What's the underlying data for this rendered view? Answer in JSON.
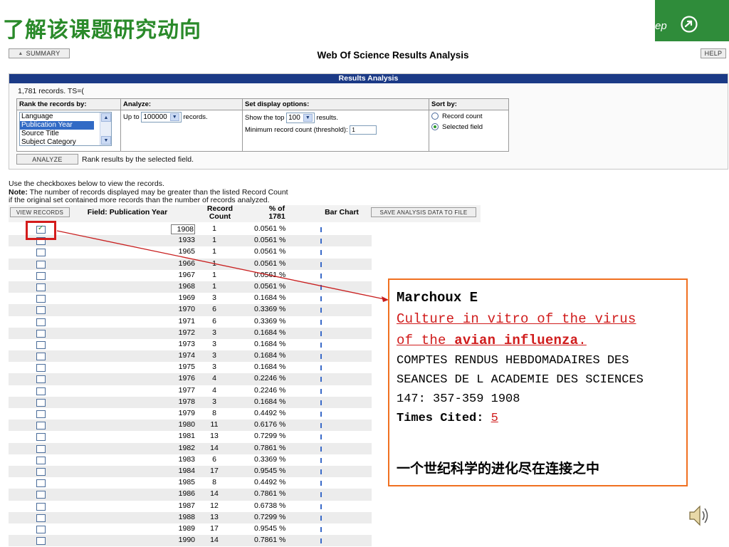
{
  "slide": {
    "title": "了解该课题研究动向",
    "step_text": "ep",
    "step_icon": "arrow-circle-icon",
    "speaker_icon": "speaker-icon"
  },
  "header": {
    "summary_label": "SUMMARY",
    "title": "Web Of Science Results Analysis",
    "help_label": "HELP"
  },
  "analysis": {
    "panel_title": "Results Analysis",
    "records_text": "1,781 records. TS=(",
    "rank_header": "Rank the records by:",
    "rank_options": [
      "Language",
      "Publication Year",
      "Source Title",
      "Subject Category"
    ],
    "rank_selected": "Publication Year",
    "analyze_header": "Analyze:",
    "analyze_prefix": "Up to",
    "analyze_value": "100000",
    "analyze_suffix": "records.",
    "display_header": "Set display options:",
    "show_prefix": "Show the top",
    "show_value": "100",
    "show_suffix": "results.",
    "threshold_label": "Minimum record count (threshold):",
    "threshold_value": "1",
    "sort_header": "Sort by:",
    "sort_options": [
      "Record count",
      "Selected field"
    ],
    "sort_selected": "Selected field",
    "analyze_button": "ANALYZE",
    "analyze_note": "Rank results by the selected field."
  },
  "instructions": {
    "line1": "Use the checkboxes below to view the records.",
    "note_label": "Note:",
    "note_text": " The number of records displayed may be greater than the listed Record Count",
    "line3": "if the original set contained more records than the number of records analyzed."
  },
  "results": {
    "view_button": "VIEW RECORDS",
    "field_header": "Field: Publication Year",
    "count_header_1": "Record",
    "count_header_2": "Count",
    "pct_header_1": "% of",
    "pct_header_2": "1781",
    "bar_header": "Bar Chart",
    "save_button": "SAVE ANALYSIS DATA TO FILE",
    "rows": [
      {
        "year": "1908",
        "count": "1",
        "pct": "0.0561 %",
        "checked": true
      },
      {
        "year": "1933",
        "count": "1",
        "pct": "0.0561 %",
        "checked": false
      },
      {
        "year": "1965",
        "count": "1",
        "pct": "0.0561 %",
        "checked": false
      },
      {
        "year": "1966",
        "count": "1",
        "pct": "0.0561 %",
        "checked": false
      },
      {
        "year": "1967",
        "count": "1",
        "pct": "0.0561 %",
        "checked": false
      },
      {
        "year": "1968",
        "count": "1",
        "pct": "0.0561 %",
        "checked": false
      },
      {
        "year": "1969",
        "count": "3",
        "pct": "0.1684 %",
        "checked": false
      },
      {
        "year": "1970",
        "count": "6",
        "pct": "0.3369 %",
        "checked": false
      },
      {
        "year": "1971",
        "count": "6",
        "pct": "0.3369 %",
        "checked": false
      },
      {
        "year": "1972",
        "count": "3",
        "pct": "0.1684 %",
        "checked": false
      },
      {
        "year": "1973",
        "count": "3",
        "pct": "0.1684 %",
        "checked": false
      },
      {
        "year": "1974",
        "count": "3",
        "pct": "0.1684 %",
        "checked": false
      },
      {
        "year": "1975",
        "count": "3",
        "pct": "0.1684 %",
        "checked": false
      },
      {
        "year": "1976",
        "count": "4",
        "pct": "0.2246 %",
        "checked": false
      },
      {
        "year": "1977",
        "count": "4",
        "pct": "0.2246 %",
        "checked": false
      },
      {
        "year": "1978",
        "count": "3",
        "pct": "0.1684 %",
        "checked": false
      },
      {
        "year": "1979",
        "count": "8",
        "pct": "0.4492 %",
        "checked": false
      },
      {
        "year": "1980",
        "count": "11",
        "pct": "0.6176 %",
        "checked": false
      },
      {
        "year": "1981",
        "count": "13",
        "pct": "0.7299 %",
        "checked": false
      },
      {
        "year": "1982",
        "count": "14",
        "pct": "0.7861 %",
        "checked": false
      },
      {
        "year": "1983",
        "count": "6",
        "pct": "0.3369 %",
        "checked": false
      },
      {
        "year": "1984",
        "count": "17",
        "pct": "0.9545 %",
        "checked": false
      },
      {
        "year": "1985",
        "count": "8",
        "pct": "0.4492 %",
        "checked": false
      },
      {
        "year": "1986",
        "count": "14",
        "pct": "0.7861 %",
        "checked": false
      },
      {
        "year": "1987",
        "count": "12",
        "pct": "0.6738 %",
        "checked": false
      },
      {
        "year": "1988",
        "count": "13",
        "pct": "0.7299 %",
        "checked": false
      },
      {
        "year": "1989",
        "count": "17",
        "pct": "0.9545 %",
        "checked": false
      },
      {
        "year": "1990",
        "count": "14",
        "pct": "0.7861 %",
        "checked": false
      }
    ]
  },
  "callout": {
    "author": "Marchoux E",
    "title_part1": "Culture in vitro of the virus",
    "title_part2": "of the ",
    "title_bold": "avian influenza",
    "title_end": ".",
    "journal_1": "COMPTES RENDUS HEBDOMADAIRES DES",
    "journal_2": "SEANCES DE L ACADEMIE DES SCIENCES",
    "citation": "147: 357-359 1908",
    "cited_label": "Times Cited: ",
    "cited_count": "5",
    "chinese_note": "一个世纪科学的进化尽在连接之中"
  },
  "colors": {
    "title_green": "#2a8a2a",
    "step_green": "#2f8c3a",
    "panel_blue": "#1b3a86",
    "highlight_red": "#d41c1c",
    "callout_border": "#f07020",
    "link_red": "#d01c1c"
  }
}
